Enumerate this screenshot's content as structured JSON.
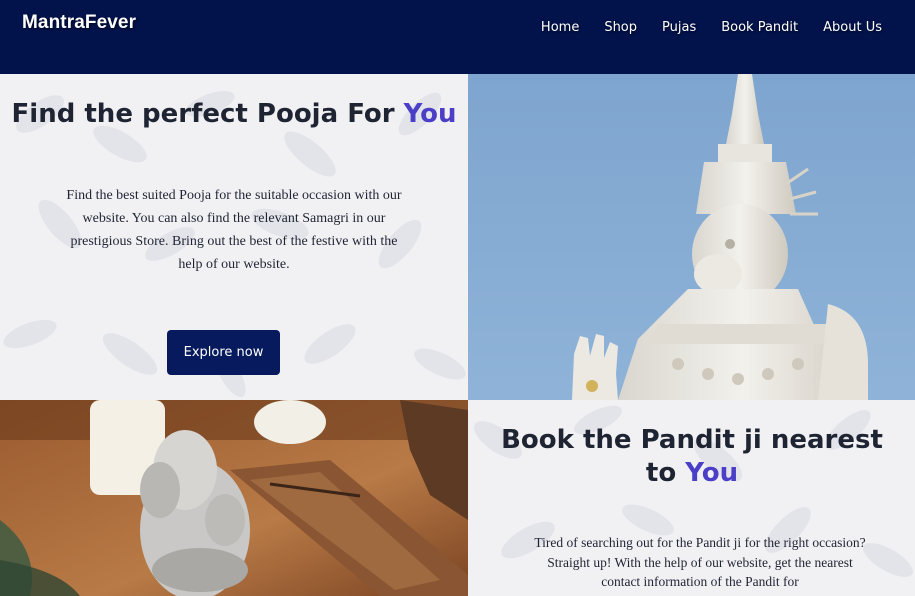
{
  "brand": {
    "name": "MantraFever"
  },
  "nav": {
    "items": [
      {
        "label": "Home"
      },
      {
        "label": "Shop"
      },
      {
        "label": "Pujas"
      },
      {
        "label": "Book Pandit"
      },
      {
        "label": "About Us"
      }
    ]
  },
  "hero": {
    "title_prefix": "Find the perfect Pooja For ",
    "title_accent": "You",
    "description": "Find the best suited Pooja for the suitable occasion with our website. You can also find the relevant Samagri in our prestigious Store. Bring out the best of the festive with the help of our website.",
    "button_label": "Explore now"
  },
  "pandit": {
    "title_prefix": "Book the Pandit ji nearest to ",
    "title_accent": "You",
    "description": "Tired of searching out for the Pandit ji for the right occasion? Straight up! With the help of our website, get the nearest contact information of the Pandit for"
  },
  "colors": {
    "navbar": "#02124a",
    "accent": "#4b3fc7",
    "button": "#071a5e",
    "pattern_bg": "#f1f1f4"
  }
}
